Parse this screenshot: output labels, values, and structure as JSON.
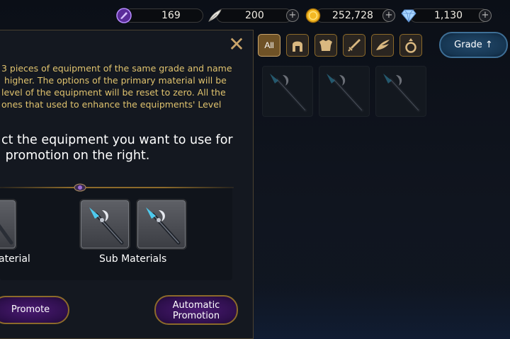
{
  "currencies": [
    {
      "icon": "purple-gem-icon",
      "value": "169"
    },
    {
      "icon": "feather-icon",
      "value": "200"
    },
    {
      "icon": "gold-coin-icon",
      "value": "252,728"
    },
    {
      "icon": "diamond-icon",
      "value": "1,130"
    }
  ],
  "plus_label": "+",
  "panel": {
    "close_label": "✕",
    "description": "3 pieces of equipment of the same grade and name\n higher. The options of the primary material will be\nlevel of the equipment will be reset to zero. All the\nones that used to enhance the equipments' Level",
    "instruction": "ct the equipment you want to use for\n promotion on the right.",
    "main_material_label": "aterial",
    "sub_materials_label": "Sub Materials",
    "promote_button": "Promote",
    "auto_promotion_button": "Automatic\nPromotion"
  },
  "filters": [
    {
      "label": "All",
      "icon": "all-icon",
      "active": true
    },
    {
      "label": "",
      "icon": "helmet-icon",
      "active": false
    },
    {
      "label": "",
      "icon": "armor-icon",
      "active": false
    },
    {
      "label": "",
      "icon": "sword-icon",
      "active": false
    },
    {
      "label": "",
      "icon": "wing-icon",
      "active": false
    },
    {
      "label": "",
      "icon": "ring-icon",
      "active": false
    }
  ],
  "sort_button": "Grade ↑",
  "inventory_count": 3,
  "colors": {
    "accent_gold": "#c9a46a",
    "text_gold": "#e0c36e",
    "button_purple": "#4a1a72",
    "button_blue": "#244a6c"
  }
}
